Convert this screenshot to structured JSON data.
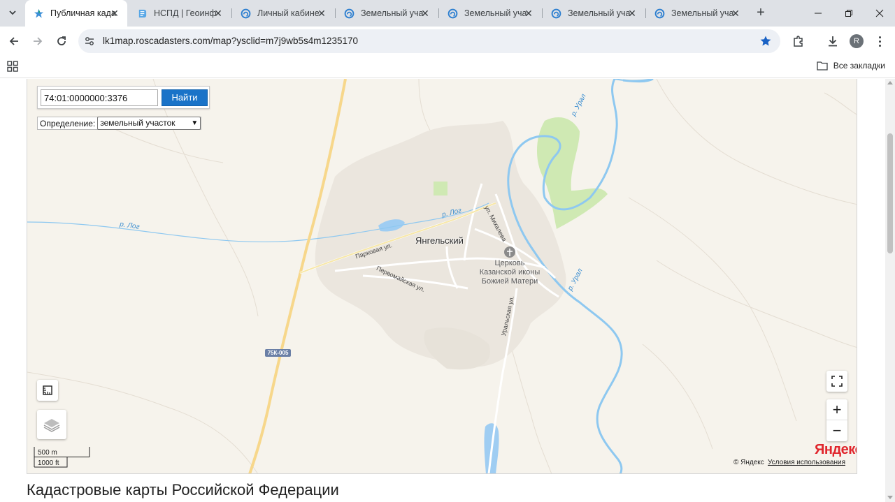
{
  "browser": {
    "tabs": [
      {
        "title": "Публичная када",
        "active": true,
        "favicon": "roscad-icon"
      },
      {
        "title": "НСПД | Геоинф",
        "active": false,
        "favicon": "nspd-icon"
      },
      {
        "title": "Личный кабине",
        "active": false,
        "favicon": "lk-icon"
      },
      {
        "title": "Земельный уча",
        "active": false,
        "favicon": "lk-icon"
      },
      {
        "title": "Земельный уча",
        "active": false,
        "favicon": "lk-icon"
      },
      {
        "title": "Земельный уча",
        "active": false,
        "favicon": "lk-icon"
      },
      {
        "title": "Земельный уча",
        "active": false,
        "favicon": "lk-icon"
      }
    ],
    "url": "lk1map.roscadasters.com/map?ysclid=m7j9wb5s4m1235170",
    "profile_initial": "R",
    "bookmarks_label": "Все закладки"
  },
  "map": {
    "search_value": "74:01:0000000:3376",
    "find_button": "Найти",
    "definition_label": "Определение:",
    "definition_selected": "земельный участок",
    "labels": {
      "town": "Янгельский",
      "church": "Церковь\nКазанской иконы\nБожией Матери",
      "river_ural_1": "р. Урал",
      "river_ural_2": "р. Урал",
      "river_log_1": "р. Лог",
      "river_log_2": "р. Лог",
      "street_parkovaya": "Парковая ул.",
      "street_pervomayskaya": "Первомайская ул.",
      "street_mikhaleva": "ул. Михалева",
      "street_uralskaya": "Уральская ул.",
      "road_badge": "75К-005"
    },
    "scale_metric": "500 m",
    "scale_imperial": "1000 ft",
    "provider_logo": "Яндекс",
    "copyright": "© Яндекс",
    "terms_link": "Условия использования",
    "zoom_in": "+",
    "zoom_out": "−"
  },
  "page": {
    "heading": "Кадастровые карты Российской Федерации"
  },
  "colors": {
    "map_bg": "#f6f3ec",
    "settlement": "#ece8e1",
    "forest": "#cfe9b3",
    "water": "#9fcdf2",
    "river_line": "#7ec3f0",
    "highway": "#f7d78b",
    "button_blue": "#1a73c8",
    "yandex_red": "#e0262d"
  }
}
